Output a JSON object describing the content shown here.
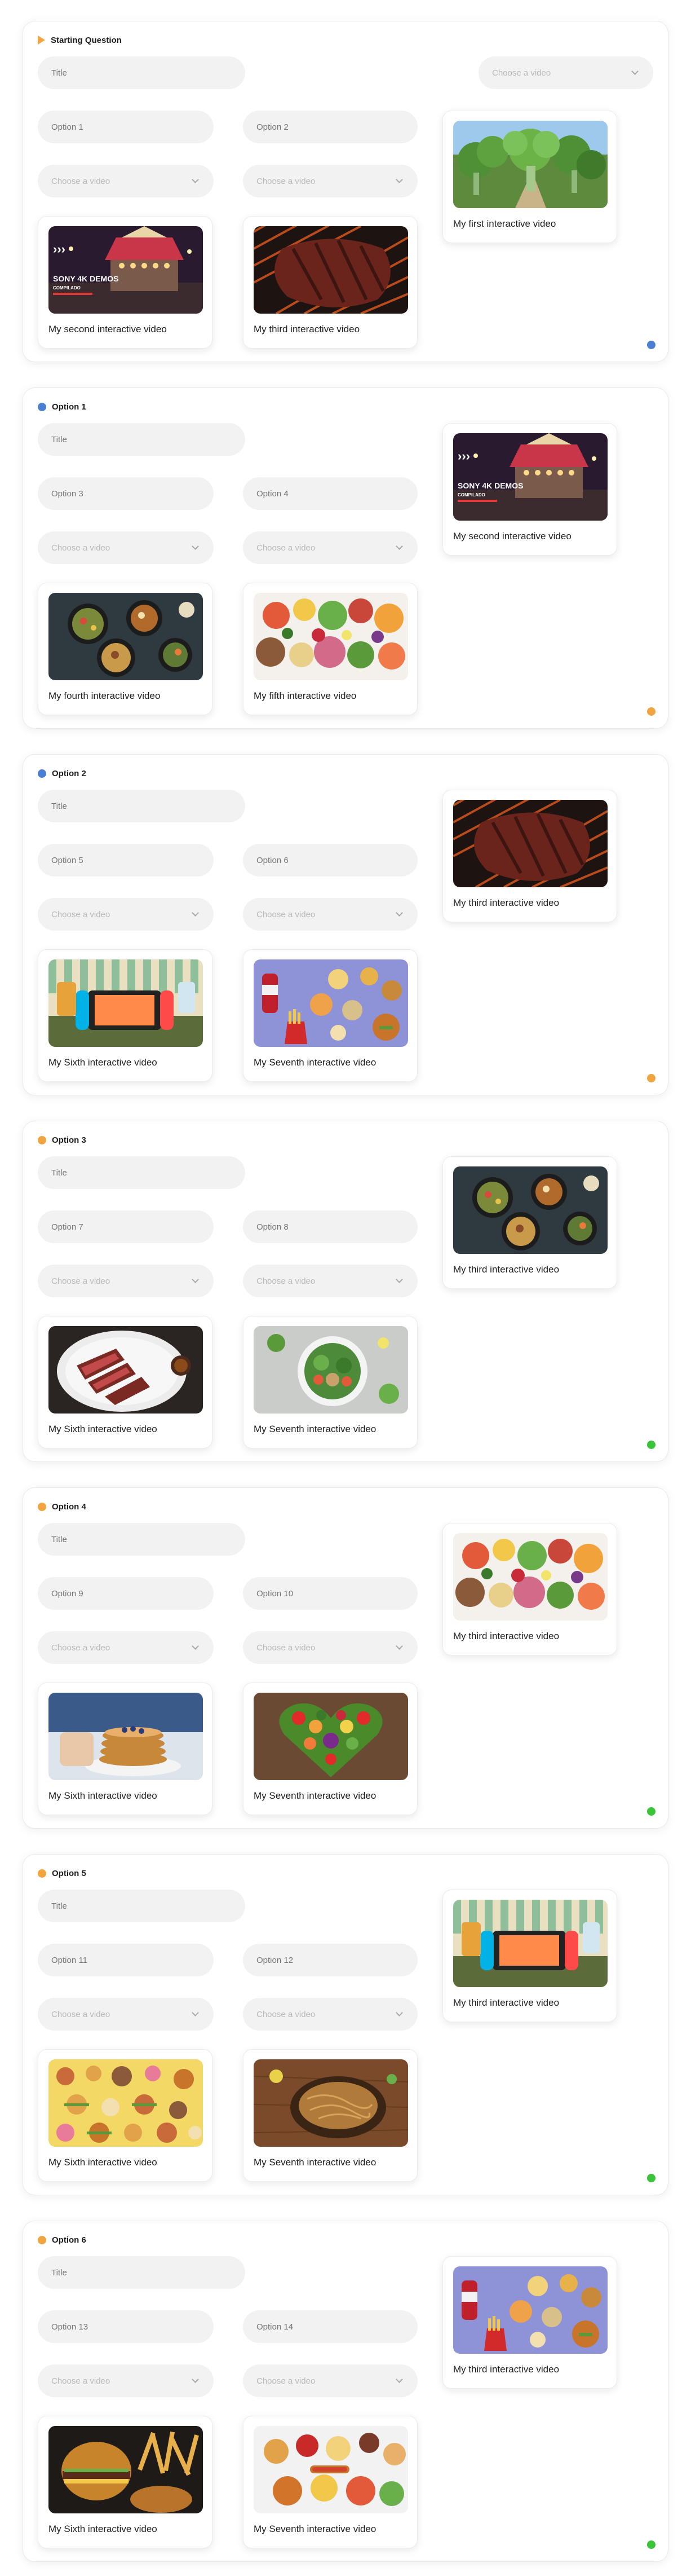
{
  "colors": {
    "blue": "#4a7fd1",
    "orange": "#f2a440",
    "green": "#3ac43a",
    "pill": "#f2f2f2",
    "placeholder": "#b9b9b9"
  },
  "sections": [
    {
      "header": {
        "icon": "play-icon",
        "marker": "orange",
        "title": "Starting Question"
      },
      "title_placeholder": "Title",
      "top_select_placeholder": "Choose a video",
      "options": [
        {
          "placeholder": "Option 1"
        },
        {
          "placeholder": "Option 2"
        }
      ],
      "select_placeholders": [
        "Choose a video",
        "Choose a video"
      ],
      "main_video": {
        "label": "My first interactive video",
        "thumb": "broccoli-forest"
      },
      "option_videos": [
        {
          "label": "My second interactive video",
          "thumb": "carnival-sony"
        },
        {
          "label": "My third interactive video",
          "thumb": "steak-grill"
        }
      ],
      "status": "blue"
    },
    {
      "header": {
        "icon": "dot-icon",
        "marker": "blue",
        "title": "Option 1"
      },
      "title_placeholder": "Title",
      "options": [
        {
          "placeholder": "Option 3"
        },
        {
          "placeholder": "Option 4"
        }
      ],
      "select_placeholders": [
        "Choose a video",
        "Choose a video"
      ],
      "main_video": {
        "label": "My second interactive video",
        "thumb": "carnival-sony"
      },
      "option_videos": [
        {
          "label": "My fourth interactive video",
          "thumb": "bowls-dark"
        },
        {
          "label": "My fifth interactive video",
          "thumb": "food-spread"
        }
      ],
      "status": "orange"
    },
    {
      "header": {
        "icon": "dot-icon",
        "marker": "blue",
        "title": "Option 2"
      },
      "title_placeholder": "Title",
      "options": [
        {
          "placeholder": "Option 5"
        },
        {
          "placeholder": "Option 6"
        }
      ],
      "select_placeholders": [
        "Choose a video",
        "Choose a video"
      ],
      "main_video": {
        "label": "My third interactive video",
        "thumb": "steak-grill"
      },
      "option_videos": [
        {
          "label": "My Sixth interactive video",
          "thumb": "game-console"
        },
        {
          "label": "My Seventh interactive video",
          "thumb": "junk-food-blue"
        }
      ],
      "status": "orange"
    },
    {
      "header": {
        "icon": "dot-icon",
        "marker": "orange",
        "title": "Option 3"
      },
      "title_placeholder": "Title",
      "options": [
        {
          "placeholder": "Option 7"
        },
        {
          "placeholder": "Option 8"
        }
      ],
      "select_placeholders": [
        "Choose a video",
        "Choose a video"
      ],
      "main_video": {
        "label": "My third interactive video",
        "thumb": "bowls-dark"
      },
      "option_videos": [
        {
          "label": "My Sixth interactive video",
          "thumb": "sliced-steak"
        },
        {
          "label": "My Seventh interactive video",
          "thumb": "salad-bowl"
        }
      ],
      "status": "green"
    },
    {
      "header": {
        "icon": "dot-icon",
        "marker": "orange",
        "title": "Option 4"
      },
      "title_placeholder": "Title",
      "options": [
        {
          "placeholder": "Option 9"
        },
        {
          "placeholder": "Option 10"
        }
      ],
      "select_placeholders": [
        "Choose a video",
        "Choose a video"
      ],
      "main_video": {
        "label": "My third interactive video",
        "thumb": "food-spread"
      },
      "option_videos": [
        {
          "label": "My Sixth interactive video",
          "thumb": "pancakes"
        },
        {
          "label": "My Seventh interactive video",
          "thumb": "veggie-heart"
        }
      ],
      "status": "green"
    },
    {
      "header": {
        "icon": "dot-icon",
        "marker": "orange",
        "title": "Option 5"
      },
      "title_placeholder": "Title",
      "options": [
        {
          "placeholder": "Option 11"
        },
        {
          "placeholder": "Option 12"
        }
      ],
      "select_placeholders": [
        "Choose a video",
        "Choose a video"
      ],
      "main_video": {
        "label": "My third interactive video",
        "thumb": "game-console"
      },
      "option_videos": [
        {
          "label": "My Sixth interactive video",
          "thumb": "junk-food-yellow"
        },
        {
          "label": "My Seventh interactive video",
          "thumb": "noodles-wood"
        }
      ],
      "status": "green"
    },
    {
      "header": {
        "icon": "dot-icon",
        "marker": "orange",
        "title": "Option 6"
      },
      "title_placeholder": "Title",
      "options": [
        {
          "placeholder": "Option 13"
        },
        {
          "placeholder": "Option 14"
        }
      ],
      "select_placeholders": [
        "Choose a video",
        "Choose a video"
      ],
      "main_video": {
        "label": "My third interactive video",
        "thumb": "junk-food-blue"
      },
      "option_videos": [
        {
          "label": "My Sixth interactive video",
          "thumb": "burgers-fries"
        },
        {
          "label": "My Seventh interactive video",
          "thumb": "party-food"
        }
      ],
      "status": "green"
    }
  ],
  "thumbnail_text": {
    "carnival-sony": [
      "SONY 4K DEMOS",
      "COMPILADO"
    ]
  }
}
